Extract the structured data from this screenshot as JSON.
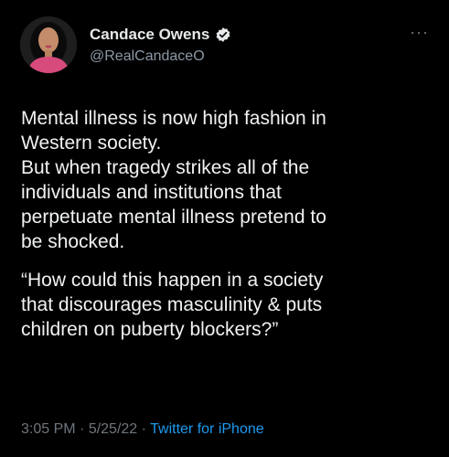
{
  "author": {
    "display_name": "Candace Owens",
    "handle": "@RealCandaceO",
    "verified": true
  },
  "more_icon": "more-dots-icon",
  "tweet": {
    "lines_p1": [
      "Mental illness is now high fashion in",
      "Western society.",
      "But when tragedy strikes all of the",
      "individuals and institutions that",
      "perpetuate mental illness pretend to",
      "be shocked."
    ],
    "lines_p2": [
      "“How could this happen in a society",
      "that discourages masculinity & puts",
      "children on puberty blockers?”"
    ]
  },
  "meta": {
    "time": "3:05 PM",
    "separator": " · ",
    "date": "5/25/22",
    "source": "Twitter for iPhone"
  },
  "colors": {
    "background": "#000000",
    "text": "#e7e9ea",
    "secondary": "#6e767d",
    "link": "#1d9bf0",
    "verified": "#e7e9ea"
  }
}
